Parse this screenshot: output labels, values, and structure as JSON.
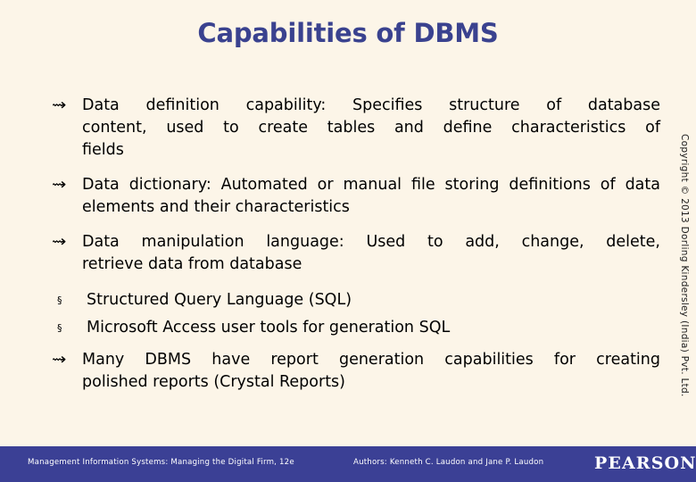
{
  "slide": {
    "title": "Capabilities of DBMS",
    "background_color": "#fcf5e8",
    "title_color": "#3a428f",
    "footer_color": "#3b4095"
  },
  "bullets": [
    {
      "marker": "arrow-bullet-glyph",
      "marker_glyph": "⇝",
      "level": 1,
      "line1": "Data definition capability: Specifies structure of database",
      "line2": "content, used to create tables and define characteristics of",
      "line3": "fields",
      "full_text": "Data definition capability: Specifies structure of database content, used to create tables and define characteristics of fields"
    },
    {
      "marker": "arrow-bullet-glyph",
      "marker_glyph": "⇝",
      "level": 1,
      "line1": "Data dictionary: Automated or manual file storing definitions of",
      "line2": "data elements and their characteristics",
      "full_text": "Data dictionary: Automated or manual file storing definitions of data elements and their characteristics"
    },
    {
      "marker": "arrow-bullet-glyph",
      "marker_glyph": "⇝",
      "level": 1,
      "line1": "Data manipulation language: Used to add, change, delete,",
      "line2": "retrieve data from database",
      "full_text": "Data manipulation language: Used to add, change, delete, retrieve data from database"
    },
    {
      "marker": "square-bullet-glyph",
      "marker_glyph": "§",
      "level": 2,
      "line1": "Structured Query Language (SQL)",
      "full_text": "Structured Query Language (SQL)"
    },
    {
      "marker": "square-bullet-glyph",
      "marker_glyph": "§",
      "level": 2,
      "line1": "Microsoft Access user tools for generation SQL",
      "full_text": "Microsoft Access user tools for generation SQL"
    },
    {
      "marker": "arrow-bullet-glyph",
      "marker_glyph": "⇝",
      "level": 1,
      "line1": "Many DBMS have report generation capabilities for creating",
      "line2": "polished reports (Crystal Reports)",
      "full_text": "Many DBMS have report generation capabilities for creating polished reports (Crystal Reports)"
    }
  ],
  "copyright": {
    "text": "Copyright © 2013 Dorling Kindersley (India) Pvt. Ltd."
  },
  "footer": {
    "course_title": "Management Information Systems: Managing the Digital Firm, 12e",
    "authors": "Authors: Kenneth C. Laudon and Jane P. Laudon",
    "publisher_logo": "PEARSON"
  }
}
